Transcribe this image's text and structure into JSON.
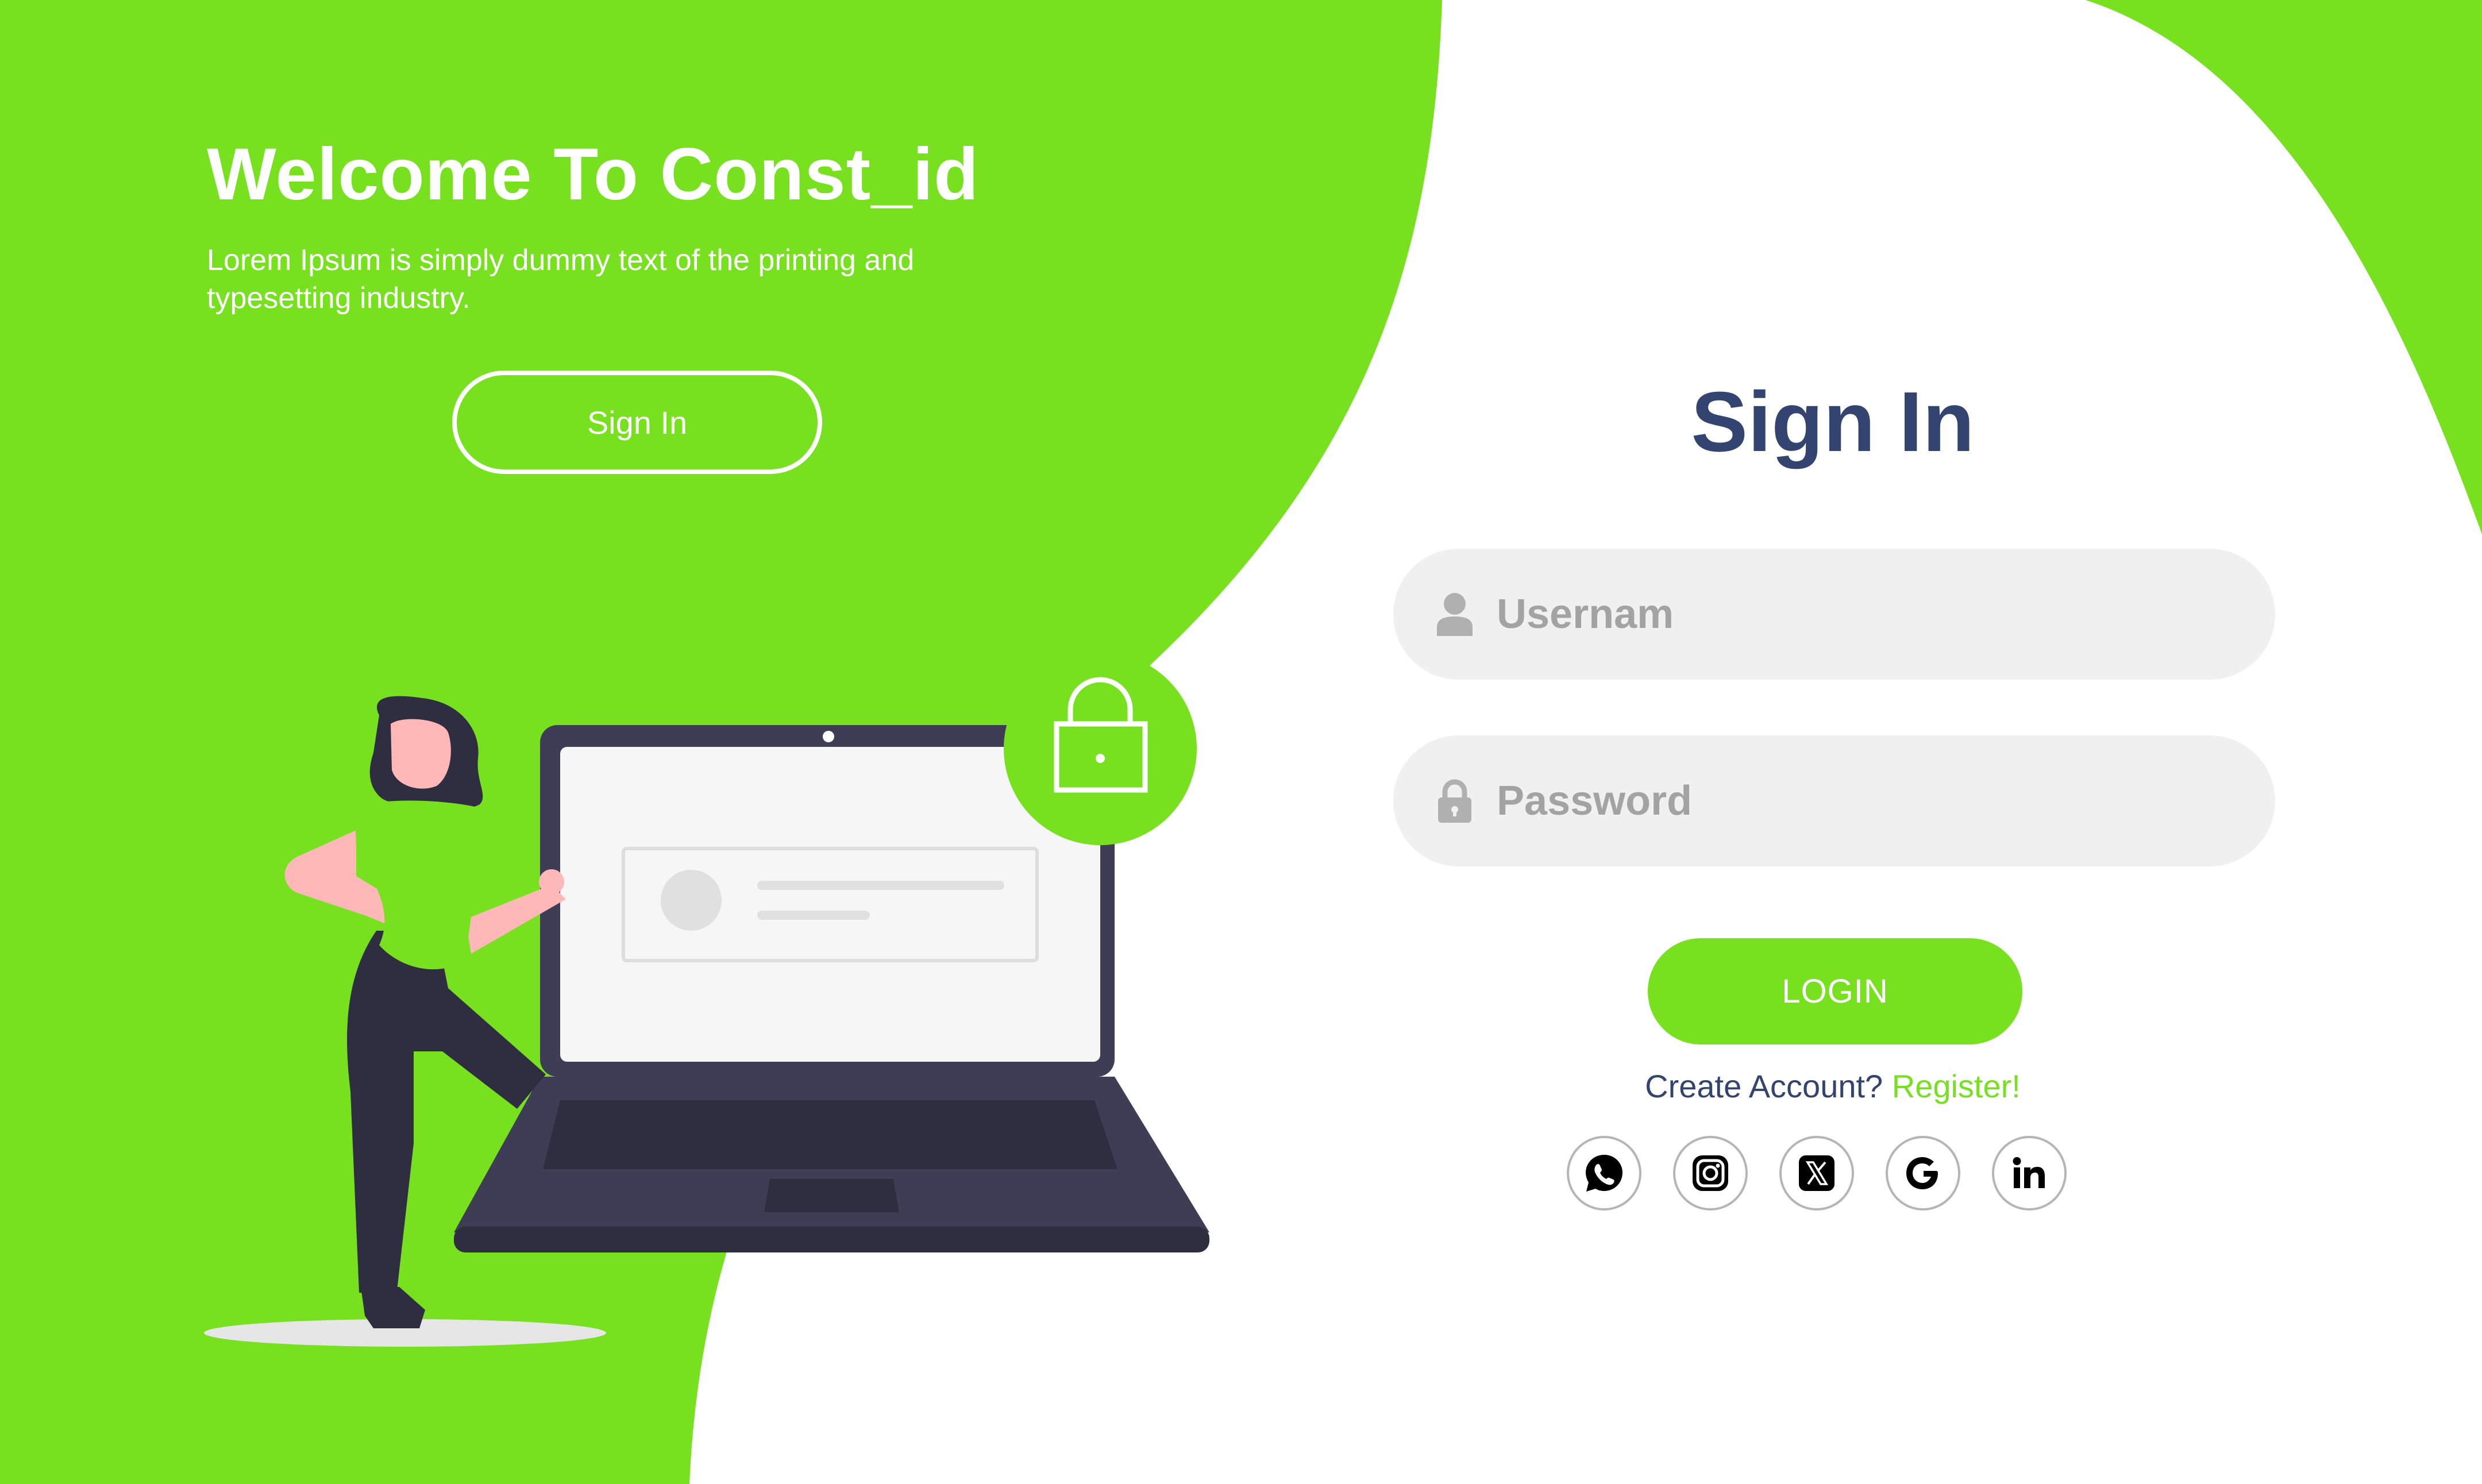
{
  "colors": {
    "accent": "#77e01f",
    "title": "#344470",
    "field_bg": "#f0f0f0",
    "placeholder": "#a3a3a3"
  },
  "hero": {
    "title": "Welcome To Const_id",
    "subtitle": "Lorem Ipsum is simply dummy text of the printing and typesetting industry.",
    "button_label": "Sign In"
  },
  "form": {
    "title": "Sign In",
    "username": {
      "placeholder": "Usernam",
      "icon": "user-icon"
    },
    "password": {
      "placeholder": "Password",
      "icon": "lock-icon"
    },
    "login_label": "LOGIN",
    "create_text": "Create Account?",
    "register_link": "Register!"
  },
  "social": [
    {
      "name": "whatsapp-icon"
    },
    {
      "name": "instagram-icon"
    },
    {
      "name": "x-icon"
    },
    {
      "name": "google-icon"
    },
    {
      "name": "linkedin-icon"
    }
  ]
}
